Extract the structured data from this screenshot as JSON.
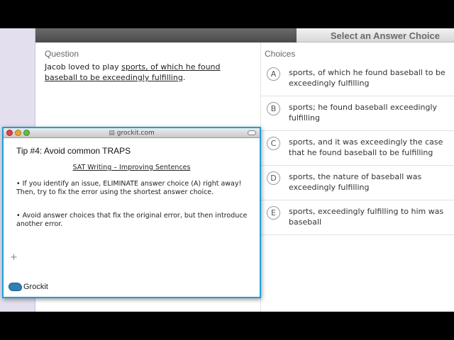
{
  "header": {
    "title": "Select an Answer Choice"
  },
  "question": {
    "label": "Question",
    "text_before": "Jacob loved to play ",
    "text_underlined": "sports, of which he found baseball to be exceedingly fulfilling",
    "text_after": "."
  },
  "choices": {
    "label": "Choices",
    "items": [
      {
        "letter": "A",
        "text": "sports, of which he found baseball to be exceedingly fulfilling"
      },
      {
        "letter": "B",
        "text": "sports; he found baseball exceedingly fulfilling"
      },
      {
        "letter": "C",
        "text": "sports, and it was exceedingly the case that he found baseball to be fulfilling"
      },
      {
        "letter": "D",
        "text": "sports, the nature of baseball was exceedingly fulfilling"
      },
      {
        "letter": "E",
        "text": "sports, exceedingly fulfilling to him was baseball"
      }
    ]
  },
  "popup": {
    "window_title": "grockit.com",
    "tip_title": "Tip #4: Avoid common TRAPS",
    "subtitle": "SAT Writing – Improving Sentences",
    "bullets": [
      "•     If you identify an issue, ELIMINATE answer choice (A) right away! Then, try to fix the error using the shortest answer choice.",
      "•     Avoid answer choices that fix the original error, but then introduce another error."
    ],
    "logo_text": "Grockit"
  },
  "colors": {
    "popup_border": "#1e9fd6",
    "logo": "#2f7fb8"
  }
}
